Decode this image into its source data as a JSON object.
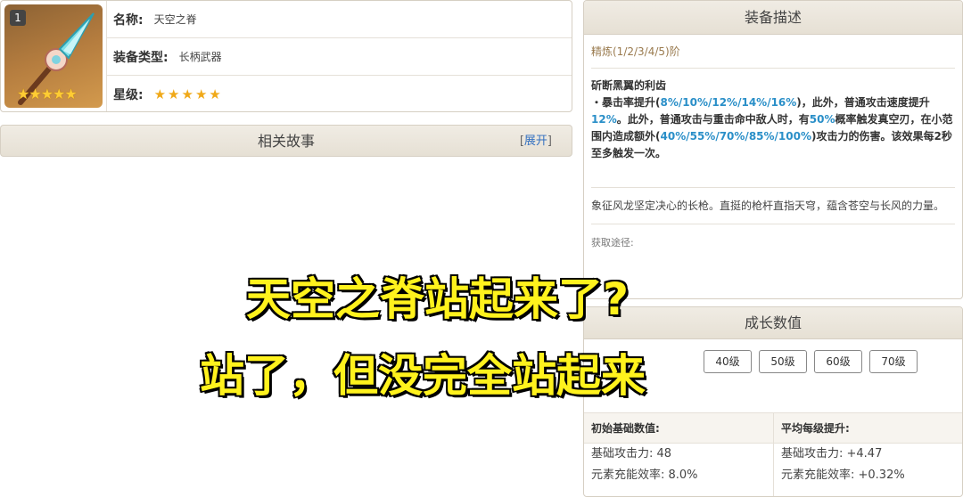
{
  "weapon": {
    "refinement_badge": "1",
    "image_stars": "★★★★★",
    "name_label": "名称:",
    "name_value": "天空之脊",
    "type_label": "装备类型:",
    "type_value": "长柄武器",
    "rarity_label": "星级:",
    "rarity_stars": "★★★★★",
    "rarity_count": 5
  },
  "story": {
    "title": "相关故事",
    "expand_open": "[",
    "expand_label": "展开",
    "expand_close": "]"
  },
  "description": {
    "title": "装备描述",
    "refine_line": "精炼(1/2/3/4/5)阶",
    "passive_name": "斫断黑翼的利齿",
    "passive_text": [
      {
        "t": "・暴击率提升("
      },
      {
        "t": "8%/10%/12%/14%/16%",
        "hl": true
      },
      {
        "t": ")，此外，普通攻击速度提升"
      },
      {
        "t": "12%",
        "hl": true
      },
      {
        "t": "。此外，普通攻击与重击命中敌人时，有"
      },
      {
        "t": "50%",
        "hl": true
      },
      {
        "t": "概率触发真空刃，在小范围内造成额外("
      },
      {
        "t": "40%/55%/70%/85%/100%",
        "hl": true
      },
      {
        "t": ")攻击力的伤害。该效果每2秒至多触发一次。"
      }
    ],
    "lore": "象征风龙坚定决心的长枪。直挺的枪杆直指天穹，蕴含苍空与长风的力量。",
    "obtain_label": "获取途径:"
  },
  "growth": {
    "title": "成长数值",
    "levels": [
      "40级",
      "50级",
      "60级",
      "70级"
    ],
    "base_header": "初始基础数值:",
    "avg_header": "平均每级提升:",
    "base_atk": "基础攻击力: 48",
    "base_er": "元素充能效率: 8.0%",
    "avg_atk": "基础攻击力: +4.47",
    "avg_er": "元素充能效率: +0.32%"
  },
  "caption": {
    "line1": "天空之脊站起来了?",
    "line2": "站了，但没完全站起来"
  },
  "colors": {
    "highlight": "#2a8fc8",
    "caption_fill": "#fff21d",
    "star": "#f0a919",
    "link": "#3370c0"
  }
}
